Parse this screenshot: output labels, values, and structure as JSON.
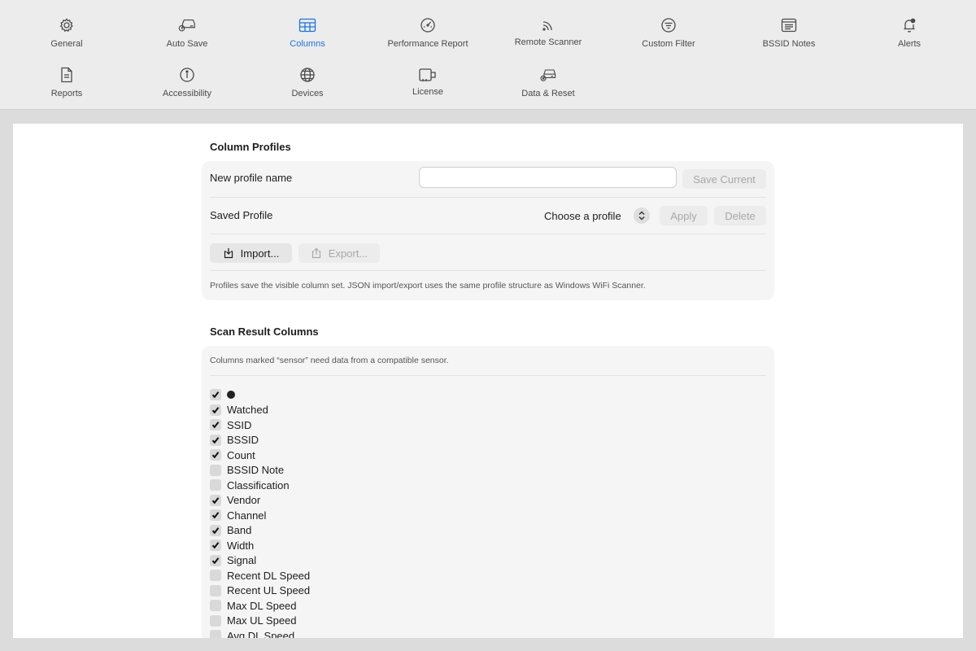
{
  "toolbar": {
    "items": [
      {
        "label": "General",
        "icon": "gear-icon"
      },
      {
        "label": "Auto Save",
        "icon": "auto-save-icon"
      },
      {
        "label": "Columns",
        "icon": "table-icon",
        "active": true
      },
      {
        "label": "Performance Report",
        "icon": "gauge-icon"
      },
      {
        "label": "Remote Scanner",
        "icon": "signal-icon"
      },
      {
        "label": "Custom Filter",
        "icon": "filter-icon"
      },
      {
        "label": "BSSID Notes",
        "icon": "note-icon"
      },
      {
        "label": "Alerts",
        "icon": "bell-icon"
      },
      {
        "label": "Reports",
        "icon": "document-icon"
      },
      {
        "label": "Accessibility",
        "icon": "accessibility-icon"
      },
      {
        "label": "Devices",
        "icon": "globe-icon"
      },
      {
        "label": "License",
        "icon": "license-icon"
      },
      {
        "label": "Data & Reset",
        "icon": "drive-reset-icon"
      }
    ],
    "active_color": "#1a73e8"
  },
  "profiles": {
    "title": "Column Profiles",
    "new_profile_label": "New profile name",
    "new_profile_value": "",
    "new_profile_placeholder": "",
    "save_current": "Save Current",
    "saved_profile_label": "Saved Profile",
    "choose_profile": "Choose a profile",
    "apply": "Apply",
    "delete": "Delete",
    "import": "Import...",
    "export": "Export...",
    "note": "Profiles save the visible column set. JSON import/export uses the same profile structure as Windows WiFi Scanner."
  },
  "scan_columns": {
    "title": "Scan Result Columns",
    "note": "Columns marked “sensor” need data from a compatible sensor.",
    "columns": [
      {
        "label": "●",
        "checked": true,
        "is_dot": true
      },
      {
        "label": "Watched",
        "checked": true
      },
      {
        "label": "SSID",
        "checked": true
      },
      {
        "label": "BSSID",
        "checked": true
      },
      {
        "label": "Count",
        "checked": true
      },
      {
        "label": "BSSID Note",
        "checked": false
      },
      {
        "label": "Classification",
        "checked": false
      },
      {
        "label": "Vendor",
        "checked": true
      },
      {
        "label": "Channel",
        "checked": true
      },
      {
        "label": "Band",
        "checked": true
      },
      {
        "label": "Width",
        "checked": true
      },
      {
        "label": "Signal",
        "checked": true
      },
      {
        "label": "Recent DL Speed",
        "checked": false
      },
      {
        "label": "Recent UL Speed",
        "checked": false
      },
      {
        "label": "Max DL Speed",
        "checked": false
      },
      {
        "label": "Max UL Speed",
        "checked": false
      },
      {
        "label": "Avg DL Speed",
        "checked": false
      }
    ]
  }
}
